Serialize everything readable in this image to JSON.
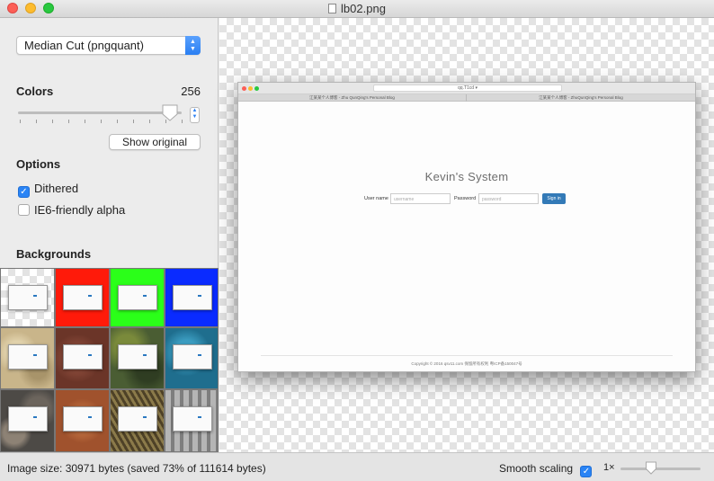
{
  "window": {
    "title": "lb02.png"
  },
  "sidebar": {
    "algorithm": "Median Cut (pngquant)",
    "colors": {
      "label": "Colors",
      "value": "256",
      "level_fraction": 0.93
    },
    "show_original_label": "Show original",
    "options": {
      "label": "Options",
      "dithered": {
        "label": "Dithered",
        "checked": true
      },
      "ie6_alpha": {
        "label": "IE6-friendly alpha",
        "checked": false
      }
    },
    "backgrounds": {
      "label": "Backgrounds",
      "swatches": [
        {
          "name": "checkerboard",
          "color": "#ffffff"
        },
        {
          "name": "red",
          "color": "#ff1a0a"
        },
        {
          "name": "green",
          "color": "#2bff19"
        },
        {
          "name": "blue",
          "color": "#0a2bff"
        },
        {
          "name": "sand",
          "color": "#c9b58a"
        },
        {
          "name": "rust",
          "color": "#6b3528"
        },
        {
          "name": "moss",
          "color": "#4a5d33"
        },
        {
          "name": "water",
          "color": "#1f6e8e"
        },
        {
          "name": "stones",
          "color": "#4d4a46"
        },
        {
          "name": "clay",
          "color": "#a0522d"
        },
        {
          "name": "grass",
          "color": "#6b5a34"
        },
        {
          "name": "metal",
          "color": "#9a9a9a"
        }
      ]
    }
  },
  "preview": {
    "page_title": "Kevin's System",
    "url_text": "qq.T1cd ▾",
    "tabs": [
      "江某某个人博客 - Zhu QunQing's Personal Blog",
      "江某某个人博客 - ZhuQunQing's Personal Blog"
    ],
    "username_label": "User name",
    "username_placeholder": "username",
    "password_label": "Password",
    "password_placeholder": "password",
    "signin_label": "Sign in",
    "footer": "Copyright © 2016 qsv11.com 保留所有权利 粤ICP备150047号"
  },
  "status": {
    "image_size": "Image size: 30971 bytes (saved 73% of 111614 bytes)",
    "smooth_scaling_label": "Smooth scaling",
    "smooth_scaling_checked": true,
    "zoom_label": "1×"
  },
  "colors": {
    "accent": "#2a84f5",
    "signin": "#337ab7"
  }
}
